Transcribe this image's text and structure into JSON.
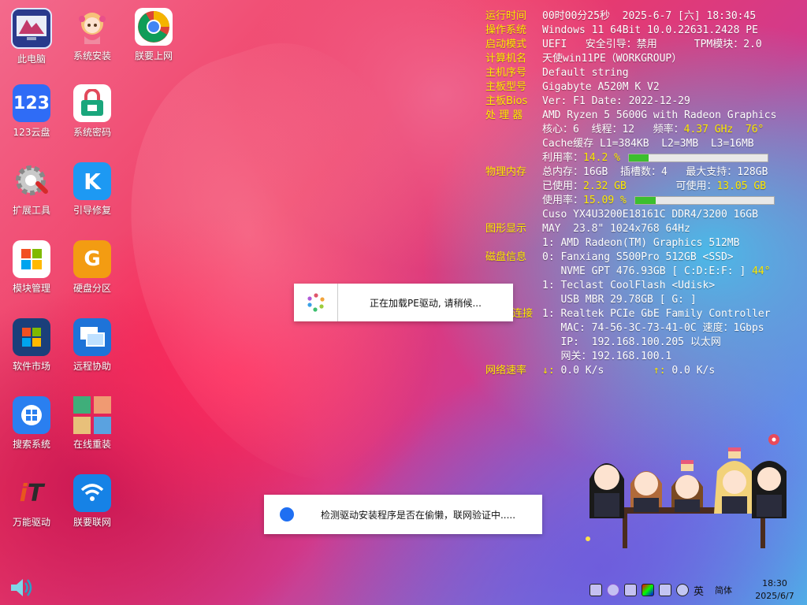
{
  "desktop": {
    "icons": [
      {
        "label": "此电脑",
        "name": "this-pc-icon"
      },
      {
        "label": "系统安装",
        "name": "system-install-icon"
      },
      {
        "label": "朕要上网",
        "name": "chrome-browser-icon"
      },
      {
        "label": "123云盘",
        "name": "cloud-drive-123-icon"
      },
      {
        "label": "系统密码",
        "name": "system-password-icon"
      },
      {
        "label": "扩展工具",
        "name": "extension-tools-icon"
      },
      {
        "label": "引导修复",
        "name": "boot-repair-icon"
      },
      {
        "label": "模块管理",
        "name": "module-manager-icon"
      },
      {
        "label": "硬盘分区",
        "name": "disk-partition-icon"
      },
      {
        "label": "软件市场",
        "name": "software-market-icon"
      },
      {
        "label": "远程协助",
        "name": "remote-assist-icon"
      },
      {
        "label": "搜索系统",
        "name": "search-system-icon"
      },
      {
        "label": "在线重装",
        "name": "online-reinstall-icon"
      },
      {
        "label": "万能驱动",
        "name": "universal-driver-icon"
      },
      {
        "label": "朕要联网",
        "name": "wifi-connect-icon"
      }
    ]
  },
  "sysinfo": {
    "l_runtime": "运行时间",
    "v_runtime": "00时00分25秒  2025-6-7 [六] 18:30:45",
    "l_os": "操作系统",
    "v_os": "Windows 11 64Bit 10.0.22631.2428 PE",
    "l_boot": "启动模式",
    "v_boot": "UEFI   安全引导：禁用      TPM模块：2.0",
    "l_pcname": "计算机名",
    "v_pcname": "天使win11PE（WORKGROUP）",
    "l_serial": "主机序号",
    "v_serial": "Default string",
    "l_board": "主板型号",
    "v_board": "Gigabyte A520M K V2",
    "l_bios": "主板Bios",
    "v_bios": "Ver: F1 Date: 2022-12-29",
    "l_cpu": "处 理 器",
    "v_cpu": "AMD Ryzen 5 5600G with Radeon Graphics",
    "v_cores": "核心：6  线程：12   频率：",
    "v_freq": "4.37 GHz  76°",
    "v_cache": "Cache缓存 L1=384KB  L2=3MB  L3=16MB",
    "v_cpu_util_label": "利用率：",
    "v_cpu_util": "14.2 %",
    "cpu_util_fraction": 0.142,
    "l_mem": "物理内存",
    "v_mem_total": "总内存：16GB  插槽数：4   最大支持：128GB",
    "v_mem_used_label": "已使用：",
    "v_mem_used": "2.32 GB",
    "v_mem_avail_label": "可使用：",
    "v_mem_avail": "13.05 GB",
    "v_mem_rate_label": "使用率：",
    "v_mem_rate": "15.09 %",
    "mem_rate_fraction": 0.1509,
    "v_mem_module": "Cuso YX4U3200E18161C DDR4/3200 16GB",
    "l_gpu": "图形显示",
    "v_monitor": "MAY  23.8\" 1024x768 64Hz",
    "v_gpu": "1: AMD Radeon(TM) Graphics 512MB",
    "l_disk": "磁盘信息",
    "v_disk0": "0: Fanxiang S500Pro 512GB <SSD>",
    "v_disk0_detail": "   NVME GPT 476.93GB [ C:D:E:F: ] ",
    "v_disk0_temp": "44°",
    "v_disk1": "1: Teclast CoolFlash <Udisk>",
    "v_disk1_detail": "   USB MBR 29.78GB [ G: ]",
    "l_net": "连接",
    "v_nic": "1: Realtek PCIe GbE Family Controller",
    "v_mac": "   MAC: 74-56-3C-73-41-0C 速度：1Gbps",
    "v_ip": "   IP:  192.168.100.205 以太网",
    "v_gw": "   网关：192.168.100.1",
    "l_speed": "网络速率",
    "v_down_arrow": "↓:",
    "v_down": " 0.0 K/s",
    "v_up_arrow": "↑:",
    "v_up": " 0.0 K/s"
  },
  "dialogs": {
    "loading_text": "正在加载PE驱动, 请稍候...",
    "detect_text": "检测驱动安装程序是否在偷懒，联网验证中....."
  },
  "taskbar": {
    "lang": "英",
    "ime": "简体",
    "time": "18:30",
    "date": "2025/6/7"
  }
}
